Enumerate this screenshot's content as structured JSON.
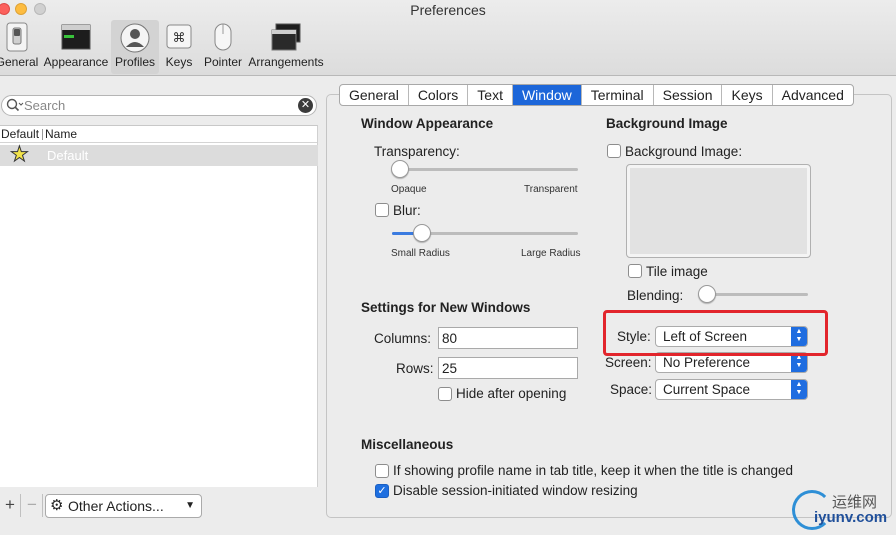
{
  "window": {
    "title": "Preferences"
  },
  "toolbar": {
    "items": [
      {
        "label": "General",
        "icon": "switch-icon"
      },
      {
        "label": "Appearance",
        "icon": "monitor-icon"
      },
      {
        "label": "Profiles",
        "icon": "profile-icon"
      },
      {
        "label": "Keys",
        "icon": "command-key-icon"
      },
      {
        "label": "Pointer",
        "icon": "mouse-icon"
      },
      {
        "label": "Arrangements",
        "icon": "windows-stack-icon"
      }
    ],
    "selected": "Profiles"
  },
  "sidebar": {
    "search_placeholder": "Search",
    "columns": {
      "default": "Default",
      "name": "Name"
    },
    "profiles": [
      {
        "name": "Default",
        "is_default": true
      }
    ],
    "add_label": "+",
    "remove_label": "−",
    "other_actions_label": "Other Actions..."
  },
  "tabs": {
    "items": [
      "General",
      "Colors",
      "Text",
      "Window",
      "Terminal",
      "Session",
      "Keys",
      "Advanced"
    ],
    "selected": "Window"
  },
  "window_appearance": {
    "title": "Window Appearance",
    "transparency_label": "Transparency:",
    "transparency_min": "Opaque",
    "transparency_max": "Transparent",
    "transparency_value": 0,
    "blur_label": "Blur:",
    "blur_checked": false,
    "blur_min": "Small Radius",
    "blur_max": "Large Radius",
    "blur_value": 0.15
  },
  "background_image": {
    "title": "Background Image",
    "checkbox_label": "Background Image:",
    "checked": false,
    "tile_label": "Tile image",
    "tile_checked": false,
    "blending_label": "Blending:",
    "blending_value": 0
  },
  "new_windows": {
    "title": "Settings for New Windows",
    "columns_label": "Columns:",
    "columns_value": "80",
    "rows_label": "Rows:",
    "rows_value": "25",
    "hide_label": "Hide after opening",
    "hide_checked": false
  },
  "placement": {
    "style_label": "Style:",
    "style_value": "Left of Screen",
    "screen_label": "Screen:",
    "screen_value": "No Preference",
    "space_label": "Space:",
    "space_value": "Current Space"
  },
  "misc": {
    "title": "Miscellaneous",
    "keep_name_label": "If showing profile name in tab title, keep it when the title is changed",
    "keep_name_checked": false,
    "disable_resize_label": "Disable session-initiated window resizing",
    "disable_resize_checked": true
  },
  "colors": {
    "accent": "#1c66d9",
    "highlight": "#e2252c"
  },
  "watermark": {
    "cn": "运维网",
    "url": "iyunv.com"
  }
}
